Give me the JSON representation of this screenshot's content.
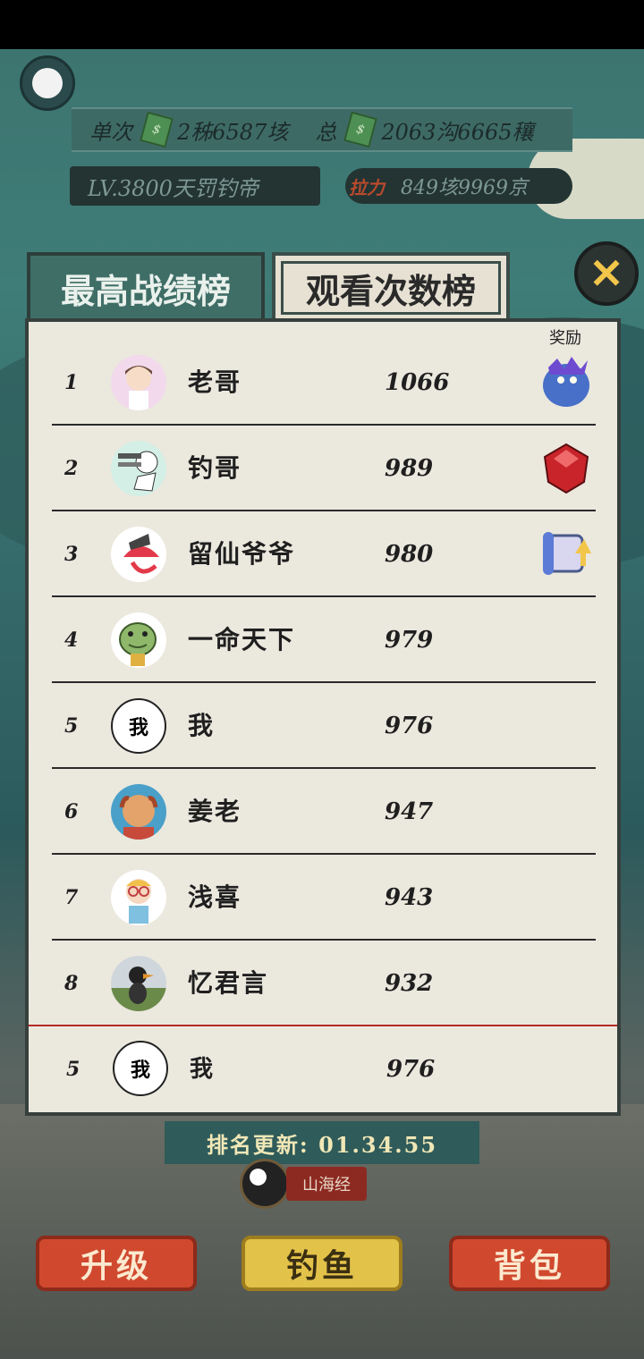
{
  "hud": {
    "single_label": "单次",
    "single_value": "2秭6587垓",
    "total_label": "总",
    "total_value": "2063沟6665穰",
    "level": "LV.3800天罚钓帝",
    "power_label": "拉力",
    "power_value": "849垓9969京"
  },
  "tabs": {
    "best": "最高战绩榜",
    "views": "观看次数榜"
  },
  "panel": {
    "reward_header": "奖励",
    "rows": [
      {
        "rank": "1",
        "avatar_text": "",
        "name": "老哥",
        "score": "1066"
      },
      {
        "rank": "2",
        "avatar_text": "",
        "name": "钓哥",
        "score": "989"
      },
      {
        "rank": "3",
        "avatar_text": "",
        "name": "留仙爷爷",
        "score": "980"
      },
      {
        "rank": "4",
        "avatar_text": "",
        "name": "一命天下",
        "score": "979"
      },
      {
        "rank": "5",
        "avatar_text": "我",
        "name": "我",
        "score": "976"
      },
      {
        "rank": "6",
        "avatar_text": "",
        "name": "姜老",
        "score": "947"
      },
      {
        "rank": "7",
        "avatar_text": "",
        "name": "浅喜",
        "score": "943"
      },
      {
        "rank": "8",
        "avatar_text": "",
        "name": "忆君言",
        "score": "932"
      }
    ],
    "my_row": {
      "rank": "5",
      "avatar_text": "我",
      "name": "我",
      "score": "976"
    }
  },
  "update": "排名更新: 01.34.55",
  "shanhai_label": "山海经",
  "buttons": {
    "upgrade": "升级",
    "fish": "钓鱼",
    "bag": "背包"
  }
}
